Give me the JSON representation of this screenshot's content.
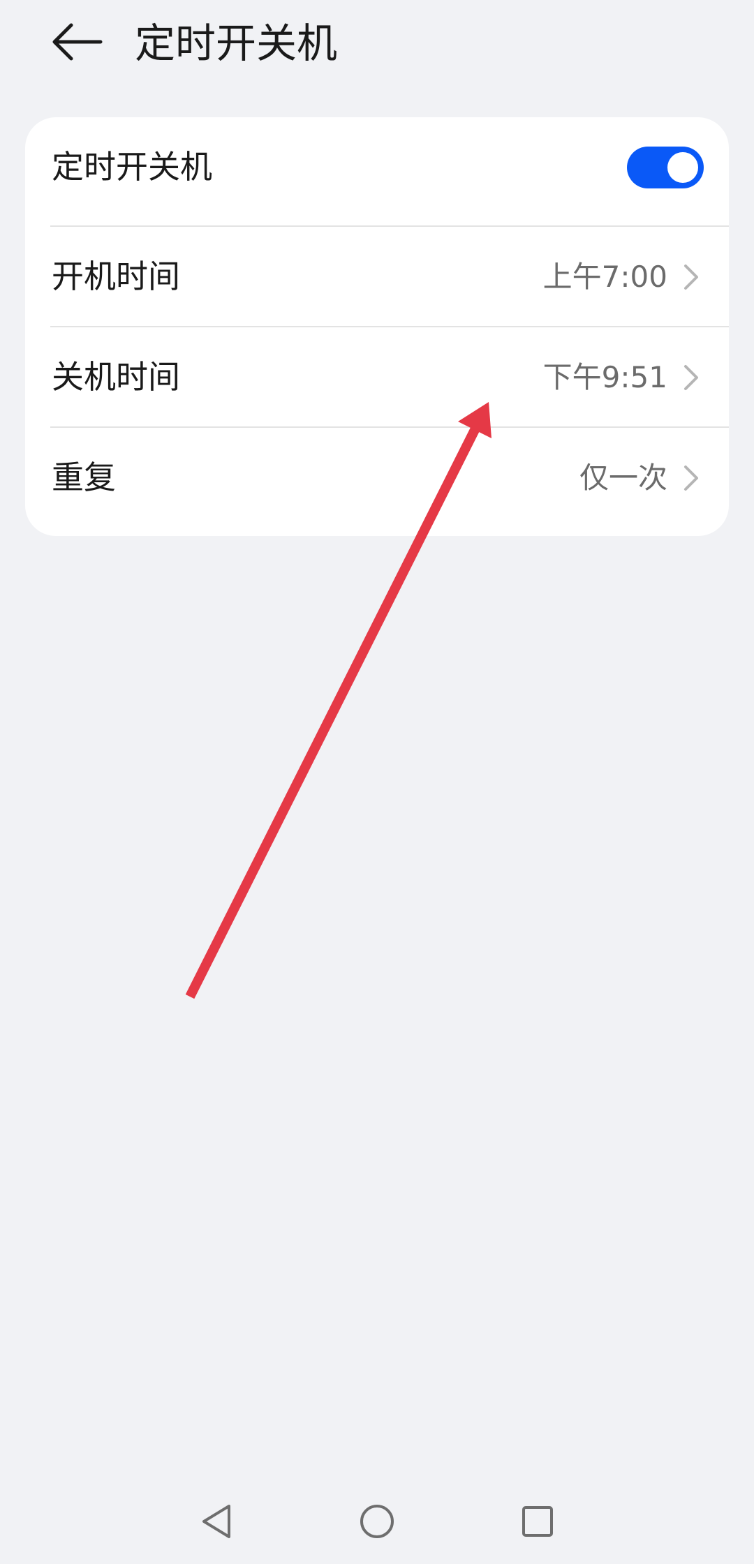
{
  "header": {
    "title": "定时开关机",
    "back_icon": "arrow-left-icon"
  },
  "settings": {
    "toggle_row": {
      "label": "定时开关机",
      "enabled": true,
      "accent_color": "#0a59f7"
    },
    "power_on_time": {
      "label": "开机时间",
      "value": "上午7:00"
    },
    "power_off_time": {
      "label": "关机时间",
      "value": "下午9:51"
    },
    "repeat": {
      "label": "重复",
      "value": "仅一次"
    }
  },
  "annotation": {
    "arrow_color": "#e53946"
  },
  "navbar": {
    "back": "triangle-back-icon",
    "home": "circle-home-icon",
    "recents": "square-recents-icon"
  }
}
